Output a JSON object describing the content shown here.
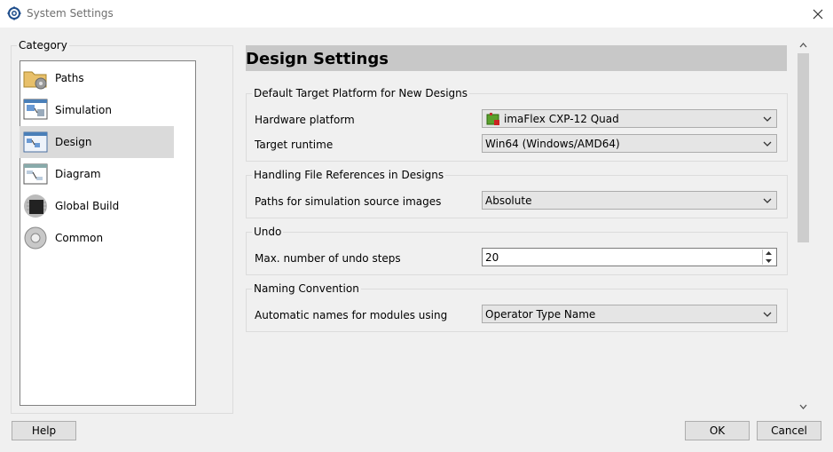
{
  "window": {
    "title": "System Settings"
  },
  "sidebar": {
    "legend": "Category",
    "items": [
      {
        "label": "Paths",
        "icon": "folder-gear-icon"
      },
      {
        "label": "Simulation",
        "icon": "simulation-icon"
      },
      {
        "label": "Design",
        "icon": "design-icon",
        "selected": true
      },
      {
        "label": "Diagram",
        "icon": "diagram-icon"
      },
      {
        "label": "Global Build",
        "icon": "chip-icon"
      },
      {
        "label": "Common",
        "icon": "gear-icon"
      }
    ]
  },
  "main": {
    "title": "Design Settings",
    "groups": [
      {
        "legend": "Default Target Platform for New Designs",
        "rows": [
          {
            "label": "Hardware platform",
            "value": "imaFlex CXP-12 Quad"
          },
          {
            "label": "Target runtime",
            "value": "Win64 (Windows/AMD64)"
          }
        ]
      },
      {
        "legend": "Handling File References in Designs",
        "rows": [
          {
            "label": "Paths for simulation source images",
            "value": "Absolute"
          }
        ]
      },
      {
        "legend": "Undo",
        "rows": [
          {
            "label": "Max. number of undo steps",
            "value": "20"
          }
        ]
      },
      {
        "legend": "Naming Convention",
        "rows": [
          {
            "label": "Automatic names for modules using",
            "value": "Operator Type Name"
          }
        ]
      }
    ]
  },
  "footer": {
    "help": "Help",
    "ok": "OK",
    "cancel": "Cancel"
  }
}
